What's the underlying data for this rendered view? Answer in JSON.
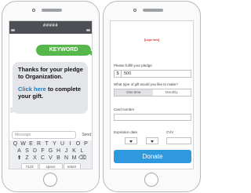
{
  "left_phone": {
    "header_number": "#####",
    "keyword_bubble": "KEYWORD",
    "reply": {
      "line1": "Thanks for your pledge",
      "line2": "to Organization.",
      "link": "Click here",
      "line3": " to complete",
      "line4": "your gift."
    },
    "message_placeholder": "Message",
    "send_label": "Send",
    "keyboard": {
      "row1": [
        "Q",
        "W",
        "E",
        "R",
        "T",
        "Y",
        "U",
        "I",
        "O",
        "P"
      ],
      "row2": [
        "A",
        "S",
        "D",
        "F",
        "G",
        "H",
        "J",
        "K",
        "L"
      ],
      "row3": [
        "Z",
        "X",
        "C",
        "V",
        "B",
        "N",
        "M"
      ],
      "shift": "⬆",
      "backspace": "⌫",
      "numbers": "?123",
      "space": "space",
      "return": "return"
    }
  },
  "right_phone": {
    "logo_placeholder": "[Logo here]",
    "pledge_label": "Please fulfill your pledge",
    "currency_symbol": "$",
    "amount_value": "500",
    "gift_type_label": "What type of gift would you like to make?",
    "gift_options": [
      "One time",
      "Monthly"
    ],
    "card_label": "Card number",
    "expiration_label": "Expiration date",
    "cvv_label": "CVV",
    "donate_label": "Donate"
  },
  "colors": {
    "keyword_bubble": "#56b84a",
    "link": "#1f7bc0",
    "donate_button": "#2f99e0",
    "logo_text": "#d62a2a"
  }
}
